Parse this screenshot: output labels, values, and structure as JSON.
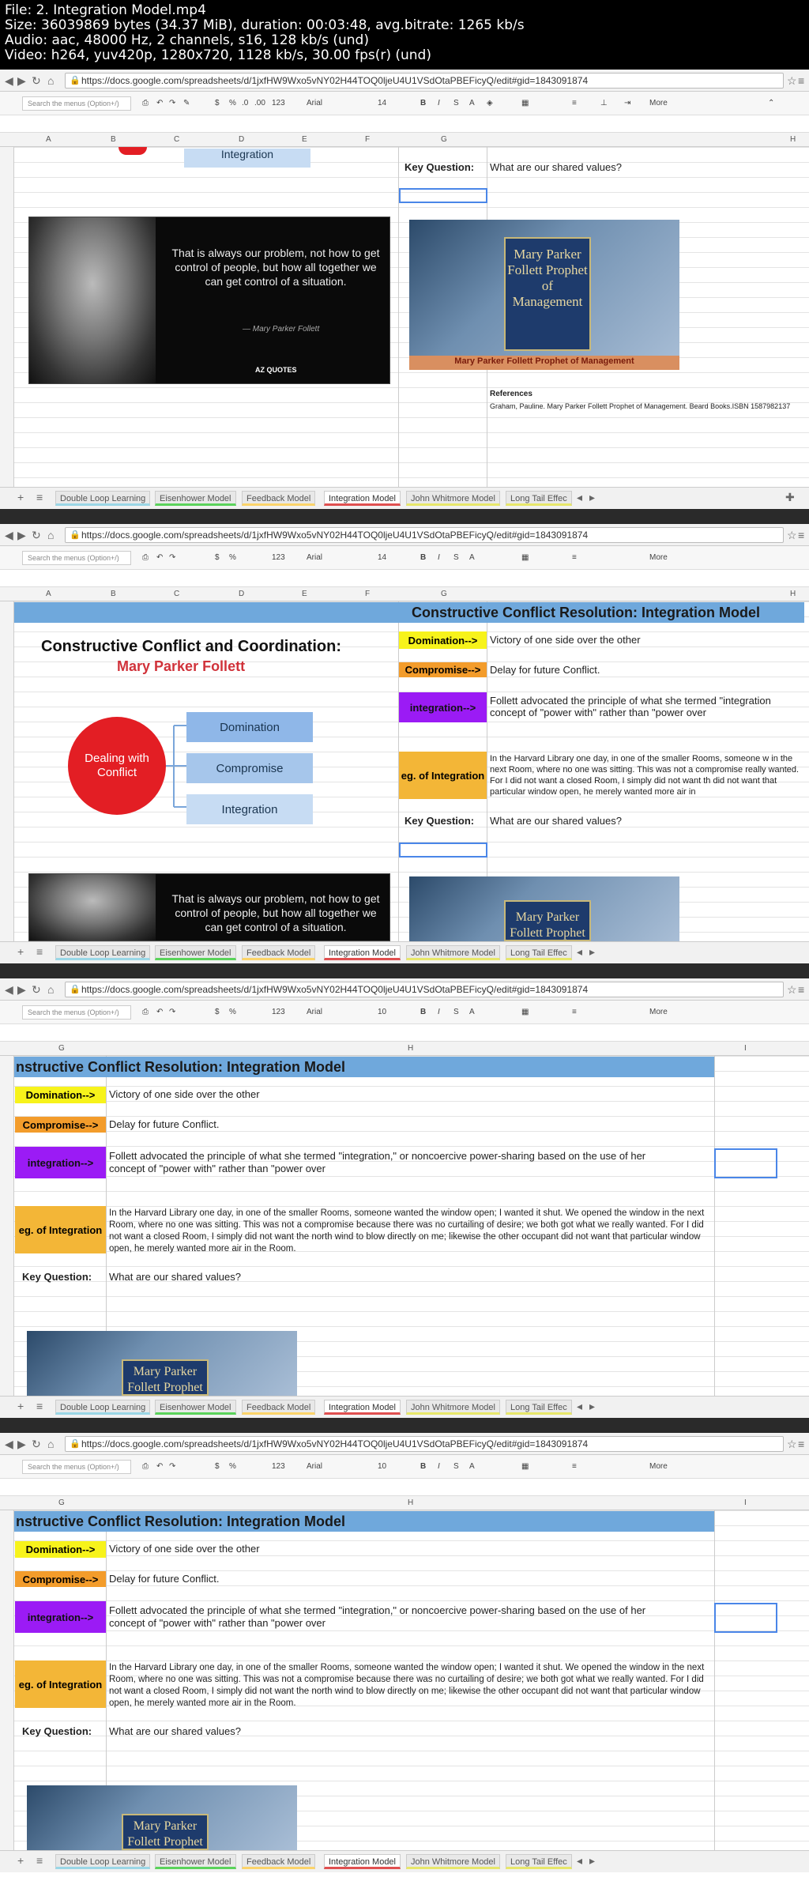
{
  "file_info": {
    "line1": "File: 2. Integration Model.mp4",
    "line2": "Size: 36039869 bytes (34.37 MiB), duration: 00:03:48, avg.bitrate: 1265 kb/s",
    "line3": "Audio: aac, 48000 Hz, 2 channels, s16, 128 kb/s (und)",
    "line4": "Video: h264, yuv420p, 1280x720, 1128 kb/s, 30.00 fps(r) (und)"
  },
  "browser": {
    "url": "https://docs.google.com/spreadsheets/d/1jxfHW9Wxo5vNY02H44TOQ0ljeU4U1VSdOtaPBEFicyQ/edit#gid=1843091874",
    "search_placeholder": "Search the menus (Option+/)",
    "font_name": "Arial",
    "font_size_14": "14",
    "font_size_10": "10",
    "zoom_format": "123",
    "more_label": "More"
  },
  "columns": {
    "frame1": [
      "A",
      "B",
      "C",
      "D",
      "E",
      "F",
      "G",
      "H"
    ],
    "frame3": [
      "G",
      "H",
      "I"
    ]
  },
  "sheet_tabs": [
    "Double Loop Learning",
    "Eisenhower Model",
    "Feedback Model",
    "Integration Model",
    "John Whitmore Model",
    "Long Tail Effec"
  ],
  "content": {
    "title": "Constructive Conflict Resolution: Integration Model",
    "title_cut": "nstructive Conflict Resolution: Integration Model",
    "domination_label": "Domination-->",
    "domination_text": "Victory of one side over the other",
    "compromise_label": "Compromise-->",
    "compromise_text": "Delay for future Conflict.",
    "integration_label": "integration-->",
    "integration_text_short": "Follett advocated the principle of what she termed \"integration",
    "integration_text_short2": "concept of \"power with\" rather than \"power over",
    "integration_text_full": "Follett advocated the principle of what she termed \"integration,\" or noncoercive power-sharing based on the use of her",
    "integration_text_full2": "concept of \"power with\" rather than \"power over",
    "eg_label": "eg. of Integration",
    "eg_text_short": "In the Harvard Library one day, in one of the smaller Rooms, someone w in the next Room, where no one was sitting. This was not a compromise really wanted. For I did not want a closed Room, I simply did not want th did not want that particular window open, he merely wanted more air in",
    "eg_text_full": "In the Harvard Library one day, in one of the smaller Rooms, someone wanted the window open; I wanted it shut. We opened the window in the next Room, where no one was sitting. This was not a compromise because there was no curtailing of desire; we both got what we really wanted. For I did not want a closed Room, I simply did not want the north wind to blow directly on me; likewise the other occupant did not want that particular window open, he merely wanted more air in the Room.",
    "key_question_label": "Key Question:",
    "key_question_text": "What are our shared values?",
    "references_label": "References",
    "references_text": "Graham, Pauline. Mary Parker Follett Prophet of Management. Beard Books.ISBN 1587982137"
  },
  "quote_image": {
    "text": "That is always our problem, not how to get control of people, but how all together we can get control of a situation.",
    "signature": "— Mary Parker Follett",
    "brand": "AZ QUOTES"
  },
  "book_image": {
    "cover_text": "Mary Parker Follett Prophet of Management",
    "caption": "Mary Parker Follett Prophet of Management"
  },
  "diagram": {
    "title": "Constructive Conflict and Coordination:",
    "subtitle": "Mary Parker Follett",
    "center": "Dealing with Conflict",
    "branch1": "Domination",
    "branch2": "Compromise",
    "branch3": "Integration"
  },
  "colors": {
    "title_bar": "#6fa8dc",
    "domination": "#f7f31b",
    "compromise": "#f39c2b",
    "integration": "#9b1bf5",
    "eg": "#f3b637",
    "selection": "#4a86e8"
  }
}
